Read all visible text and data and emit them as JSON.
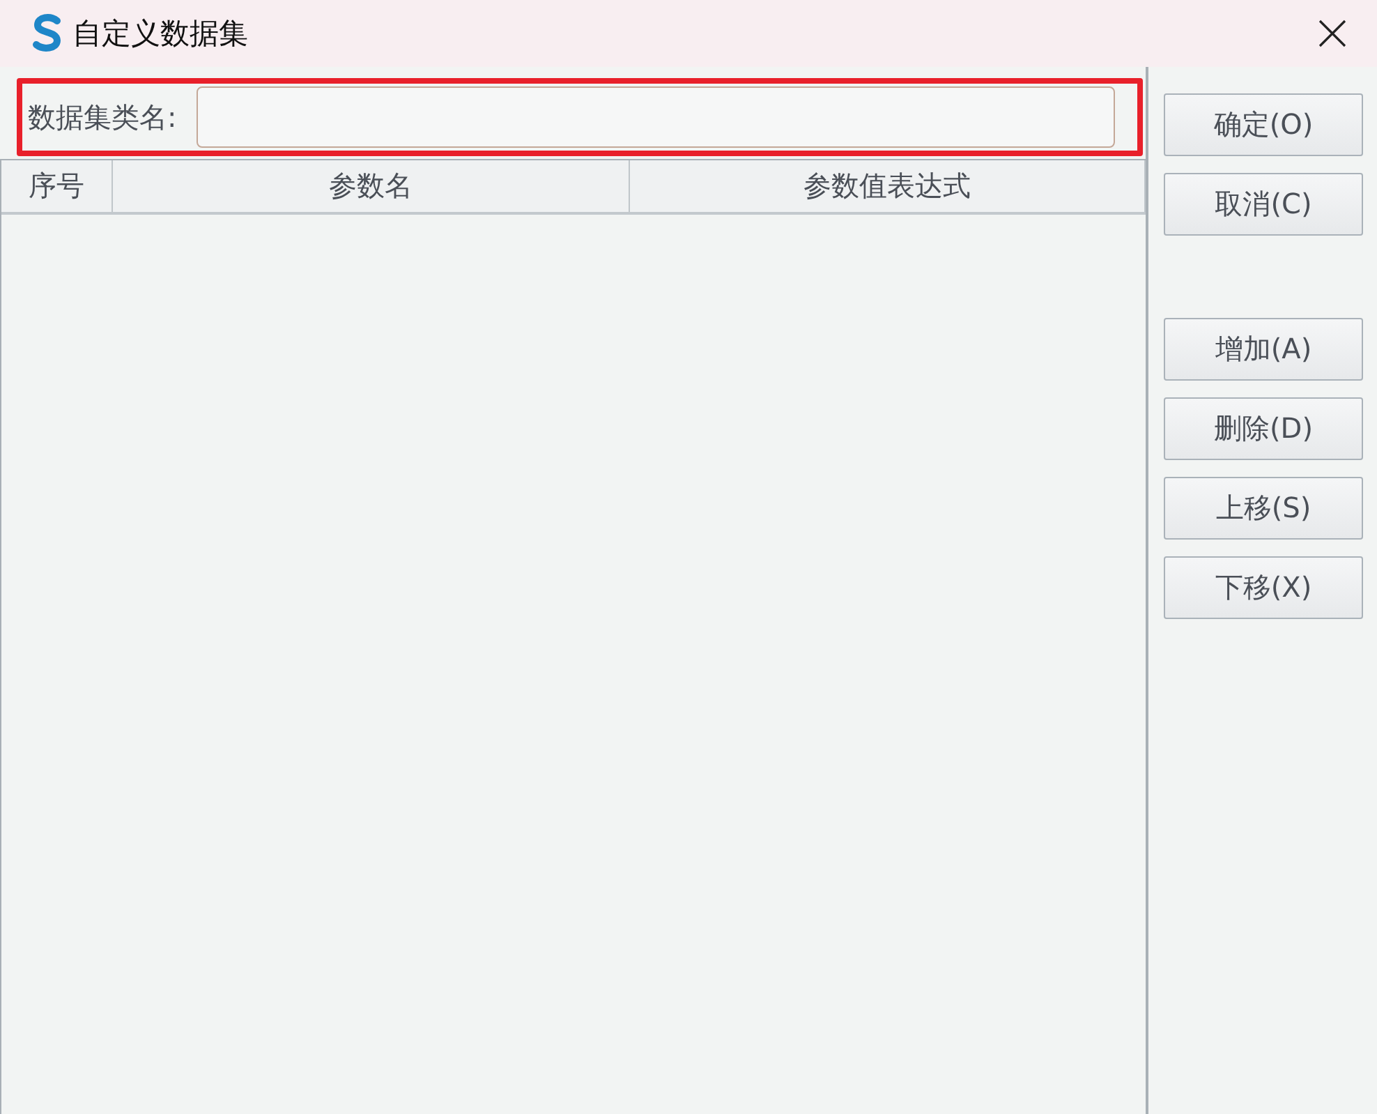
{
  "window": {
    "title": "自定义数据集"
  },
  "name_field": {
    "label": "数据集类名:",
    "highlighted": true
  },
  "table": {
    "columns": [
      "序号",
      "参数名",
      "参数值表达式"
    ]
  },
  "top_buttons": [
    "确定(O)",
    "取消(C)"
  ],
  "edit_buttons": [
    "增加(A)",
    "删除(D)",
    "上移(S)",
    "下移(X)"
  ]
}
